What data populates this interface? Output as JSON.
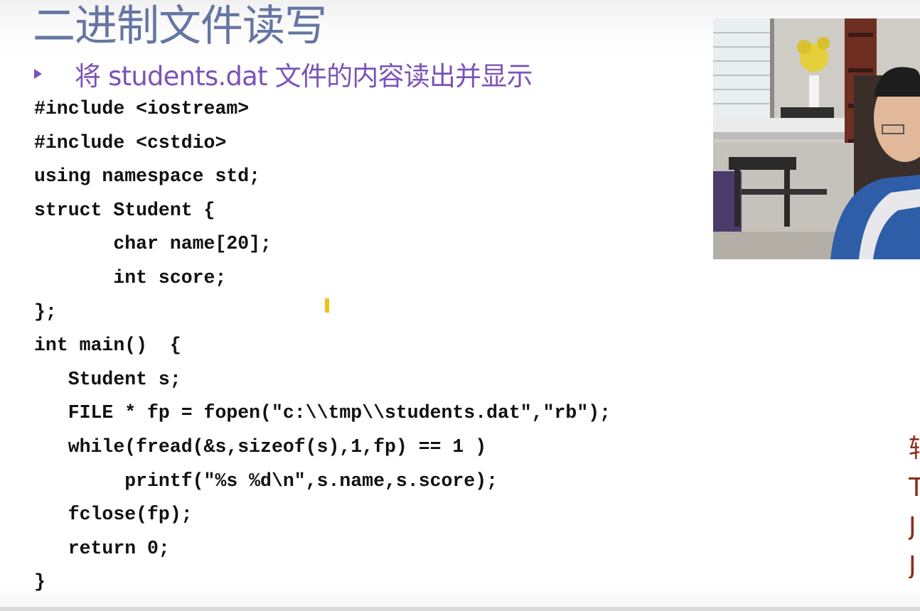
{
  "slide": {
    "title": "二进制文件读写",
    "bullet": "将 students.dat 文件的内容读出并显示",
    "bullet_icon": "arrow-bullet-icon",
    "colors": {
      "title": "#6576a3",
      "bullet": "#7b53b8",
      "code": "#111111",
      "side_text": "#8c2d1e"
    }
  },
  "code_lines": [
    "#include <iostream>",
    "#include <cstdio>",
    "using namespace std;",
    "struct Student {",
    "       char name[20];",
    "       int score;",
    "};",
    "int main()  {",
    "   Student s;",
    "   FILE * fp = fopen(\"c:\\\\tmp\\\\students.dat\",\"rb\");",
    "   while(fread(&s,sizeof(s),1,fp) == 1 )",
    "        printf(\"%s %d\\n\",s.name,s.score);",
    "   fclose(fp);",
    "   return 0;",
    "}"
  ],
  "side_panel": {
    "chars": [
      "辅",
      "T",
      "J",
      "J"
    ]
  }
}
